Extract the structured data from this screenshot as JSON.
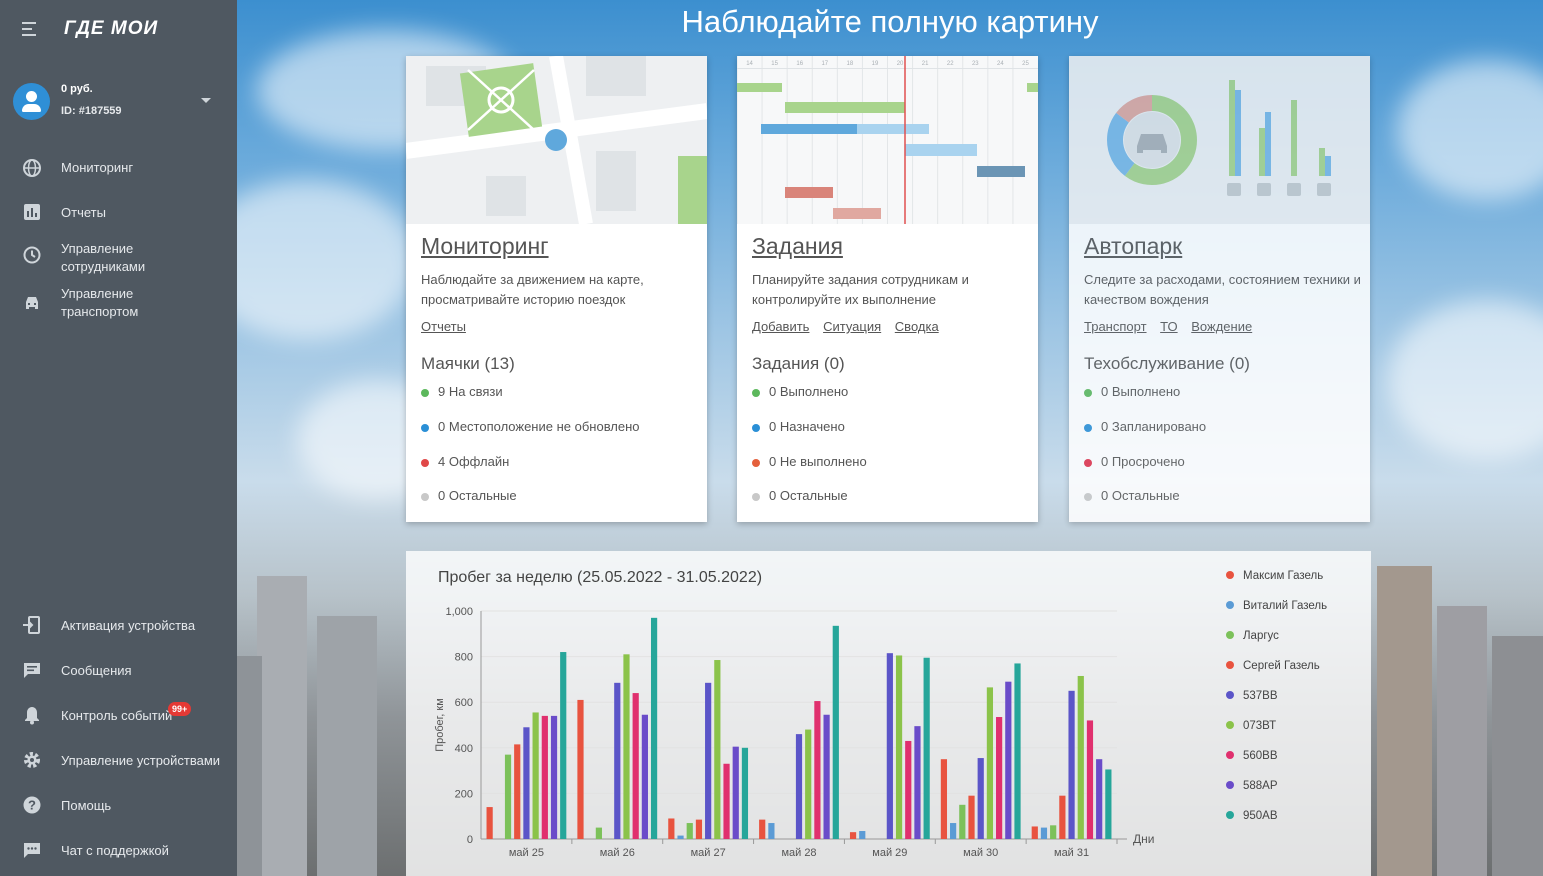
{
  "sidebar": {
    "logo_text": "ГДЕ МОИ",
    "account": {
      "balance": "0 руб.",
      "id": "ID: #187559"
    },
    "nav": [
      {
        "label": "Мониторинг",
        "icon": "globe-icon"
      },
      {
        "label": "Отчеты",
        "icon": "bar-chart-icon"
      },
      {
        "label": "Управление сотрудниками",
        "icon": "clock-icon"
      },
      {
        "label": "Управление транспортом",
        "icon": "car-icon"
      }
    ],
    "bottom_nav": [
      {
        "label": "Активация устройства",
        "icon": "device-enter-icon"
      },
      {
        "label": "Сообщения",
        "icon": "message-icon"
      },
      {
        "label": "Контроль событий",
        "icon": "bell-icon",
        "badge": "99+"
      },
      {
        "label": "Управление устройствами",
        "icon": "gear-icon"
      },
      {
        "label": "Помощь",
        "icon": "help-icon"
      },
      {
        "label": "Чат с поддержкой",
        "icon": "chat-icon"
      }
    ]
  },
  "hero_title": "Наблюдайте полную картину",
  "cards": [
    {
      "title": "Мониторинг",
      "description": "Наблюдайте за движением на карте, просматривайте историю поездок",
      "links": [
        "Отчеты"
      ],
      "subtitle": "Маячки (13)",
      "stats": [
        {
          "text": "9 На связи",
          "color": "#5cb85c"
        },
        {
          "text": "0 Местоположение не обновлено",
          "color": "#2a8fd6"
        },
        {
          "text": "4 Оффлайн",
          "color": "#e04848"
        },
        {
          "text": "0 Остальные",
          "color": "#c8c8c8"
        }
      ]
    },
    {
      "title": "Задания",
      "description": "Планируйте задания сотрудникам и контролируйте их выполнение",
      "links": [
        "Добавить",
        "Ситуация",
        "Сводка"
      ],
      "subtitle": "Задания (0)",
      "stats": [
        {
          "text": "0 Выполнено",
          "color": "#5cb85c"
        },
        {
          "text": "0 Назначено",
          "color": "#2a8fd6"
        },
        {
          "text": "0 Не выполнено",
          "color": "#e4603c"
        },
        {
          "text": "0 Остальные",
          "color": "#c8c8c8"
        }
      ]
    },
    {
      "title": "Автопарк",
      "description": "Следите за расходами, состоянием техники и качеством вождения",
      "links": [
        "Транспорт",
        "ТО",
        "Вождение"
      ],
      "subtitle": "Техобслуживание (0)",
      "stats": [
        {
          "text": "0 Выполнено",
          "color": "#5cb85c"
        },
        {
          "text": "0 Запланировано",
          "color": "#2a8fd6"
        },
        {
          "text": "0 Просрочено",
          "color": "#e0304a"
        },
        {
          "text": "0 Остальные",
          "color": "#c8c8c8"
        }
      ]
    }
  ],
  "gantt_ticks": [
    "14",
    "15",
    "16",
    "17",
    "18",
    "19",
    "20",
    "21",
    "22",
    "23",
    "24",
    "25"
  ],
  "chart_data": {
    "type": "bar",
    "title": "Пробег за неделю (25.05.2022 - 31.05.2022)",
    "xlabel": "Дни",
    "ylabel": "Пробег, км",
    "ylim": [
      0,
      1000
    ],
    "yticks": [
      "0",
      "200",
      "400",
      "600",
      "800",
      "1,000"
    ],
    "categories": [
      "май 25",
      "май 26",
      "май 27",
      "май 28",
      "май 29",
      "май 30",
      "май 31"
    ],
    "series": [
      {
        "name": "Максим Газель",
        "color": "#e8533f",
        "values": [
          140,
          610,
          90,
          85,
          30,
          350,
          55
        ]
      },
      {
        "name": "Виталий Газель",
        "color": "#5b9bd5",
        "values": [
          0,
          0,
          15,
          70,
          35,
          70,
          50
        ]
      },
      {
        "name": "Ларгус",
        "color": "#7cc15a",
        "values": [
          370,
          50,
          70,
          0,
          0,
          150,
          60
        ]
      },
      {
        "name": "Сергей Газель",
        "color": "#e8533f",
        "values": [
          415,
          0,
          85,
          0,
          0,
          190,
          190
        ]
      },
      {
        "name": "537ВВ",
        "color": "#5b55c8",
        "values": [
          490,
          685,
          685,
          460,
          815,
          355,
          650
        ]
      },
      {
        "name": "073ВТ",
        "color": "#8bc34a",
        "values": [
          555,
          810,
          785,
          480,
          805,
          665,
          715
        ]
      },
      {
        "name": "560ВВ",
        "color": "#e0306e",
        "values": [
          540,
          640,
          330,
          605,
          430,
          535,
          520
        ]
      },
      {
        "name": "588АР",
        "color": "#6a4cc9",
        "values": [
          540,
          545,
          405,
          545,
          495,
          690,
          350
        ]
      },
      {
        "name": "950АВ",
        "color": "#26a69a",
        "values": [
          820,
          970,
          400,
          935,
          795,
          770,
          305
        ]
      }
    ]
  }
}
